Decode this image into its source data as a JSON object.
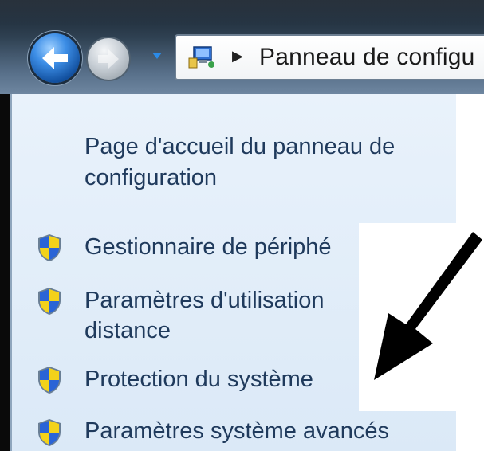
{
  "address_bar": {
    "breadcrumb": "Panneau de configu"
  },
  "task_pane": {
    "home_link": [
      "Page d'accueil du panneau de",
      "configuration"
    ],
    "items": [
      {
        "label": [
          "Gestionnaire de périphé"
        ],
        "icon": "uac-shield-icon"
      },
      {
        "label": [
          "Paramètres d'utilisation",
          "distance"
        ],
        "icon": "uac-shield-icon"
      },
      {
        "label": [
          "Protection du système"
        ],
        "icon": "uac-shield-icon"
      },
      {
        "label": [
          "Paramètres système avancés"
        ],
        "icon": "uac-shield-icon"
      }
    ]
  },
  "colors": {
    "link_text": "#1f3a5c",
    "pane_background": "#e3eef9",
    "title_band": "#3a4e63"
  }
}
